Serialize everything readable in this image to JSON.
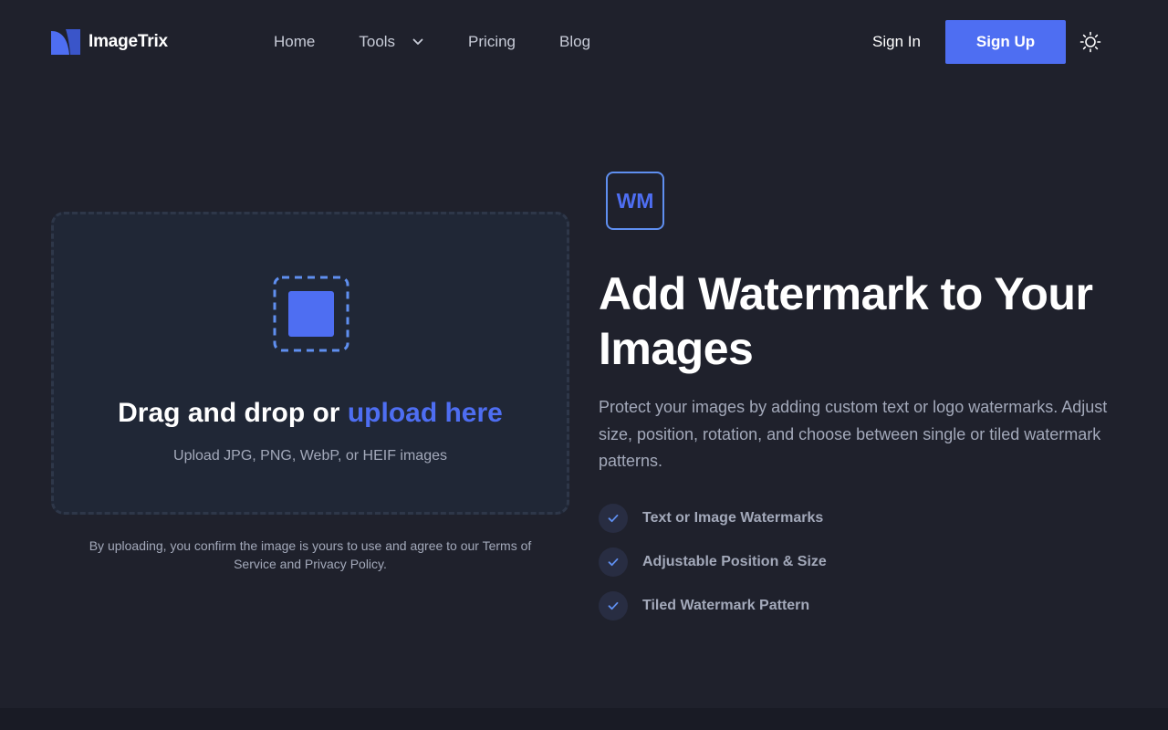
{
  "brand": {
    "name": "ImageTrix",
    "color": "#4e6ef2"
  },
  "nav": {
    "items": [
      {
        "label": "Home"
      },
      {
        "label": "Tools",
        "has_dropdown": true
      },
      {
        "label": "Pricing"
      },
      {
        "label": "Blog"
      }
    ]
  },
  "auth": {
    "sign_in": "Sign In",
    "sign_up": "Sign Up"
  },
  "theme_toggle": {
    "icon": "sun-icon"
  },
  "upload": {
    "title_prefix": "Drag and drop or ",
    "title_link": "upload here",
    "formats": "Upload JPG, PNG, WebP, or HEIF images",
    "disclaimer": "By uploading, you confirm the image is yours to use and agree to our Terms of Service and Privacy Policy."
  },
  "hero": {
    "badge": "WM",
    "title": "Add Watermark to Your Images",
    "description": "Protect your images by adding custom text or logo watermarks. Adjust size, position, rotation, and choose between single or tiled watermark patterns."
  },
  "features": [
    {
      "label": "Text or Image Watermarks"
    },
    {
      "label": "Adjustable Position & Size"
    },
    {
      "label": "Tiled Watermark Pattern"
    }
  ],
  "colors": {
    "background": "#1f212c",
    "accent": "#4e6ef2",
    "muted_text": "#a3a9ba",
    "card": "#202736"
  }
}
